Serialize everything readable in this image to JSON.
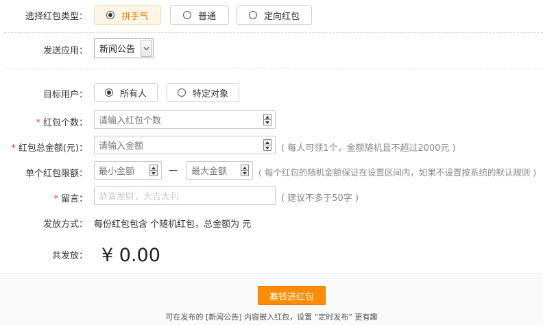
{
  "packet_type": {
    "label": "选择红包类型：",
    "options": [
      {
        "text": "拼手气",
        "selected": true
      },
      {
        "text": "普通",
        "selected": false
      },
      {
        "text": "定向红包",
        "selected": false
      }
    ]
  },
  "send_app": {
    "label": "发送应用：",
    "selected": "新闻公告"
  },
  "target_users": {
    "label": "目标用户：",
    "options": [
      {
        "text": "所有人",
        "selected": true
      },
      {
        "text": "特定对象",
        "selected": false
      }
    ]
  },
  "count": {
    "required_mark": "*",
    "label": "红包个数：",
    "placeholder": "请输入红包个数"
  },
  "total_amount": {
    "required_mark": "*",
    "label": "红包总金额(元)：",
    "placeholder": "请输入金额",
    "hint": "( 每人可领1个，金额随机且不超过2000元 )"
  },
  "limit": {
    "label": "单个红包限额：",
    "min_placeholder": "最小金额",
    "separator": "—",
    "max_placeholder": "最大金额",
    "hint": "( 每个红包的随机金额保证在设置区间内，如果不设置按系统的默认规则 )"
  },
  "message": {
    "required_mark": "*",
    "label": "留言：",
    "placeholder": "恭喜发财，大吉大利",
    "hint": "( 建议不多于50字 )"
  },
  "distribution": {
    "label": "发放方式：",
    "text": "每份红包包含 个随机红包，总金额为 元"
  },
  "total": {
    "label": "共发放：",
    "value": "¥ 0.00"
  },
  "submit_label": "塞钱进红包",
  "footnote": "可在发布的 [新闻公告] 内容嵌入红包，设置 “定时发布” 更有趣",
  "colors": {
    "accent": "#ff8c00",
    "selected_bg": "#fff6e6",
    "required": "#e4393c"
  }
}
